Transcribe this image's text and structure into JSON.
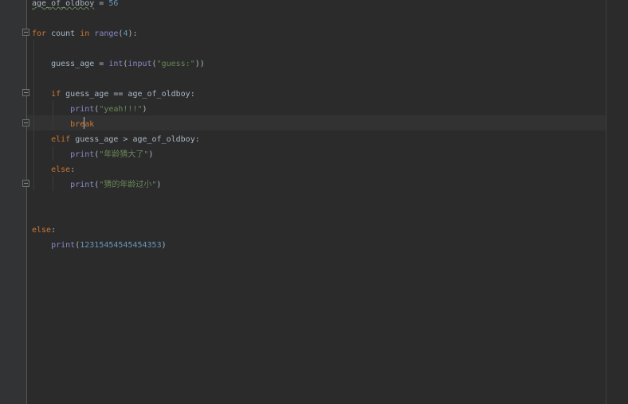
{
  "editor": {
    "lines": [
      {
        "parts": [
          {
            "t": "age_of_oldboy",
            "c": "var squiggle"
          },
          {
            "t": " = ",
            "c": "var"
          },
          {
            "t": "56",
            "c": "num"
          }
        ]
      },
      {
        "parts": []
      },
      {
        "parts": [
          {
            "t": "for",
            "c": "kw"
          },
          {
            "t": " count ",
            "c": "var"
          },
          {
            "t": "in",
            "c": "kw"
          },
          {
            "t": " ",
            "c": "var"
          },
          {
            "t": "range",
            "c": "bi"
          },
          {
            "t": "(",
            "c": "var"
          },
          {
            "t": "4",
            "c": "num"
          },
          {
            "t": "):",
            "c": "var"
          }
        ]
      },
      {
        "parts": []
      },
      {
        "parts": [
          {
            "t": "    guess_age = ",
            "c": "var"
          },
          {
            "t": "int",
            "c": "bi"
          },
          {
            "t": "(",
            "c": "var"
          },
          {
            "t": "input",
            "c": "bi"
          },
          {
            "t": "(",
            "c": "var"
          },
          {
            "t": "\"guess:\"",
            "c": "str"
          },
          {
            "t": "))",
            "c": "var"
          }
        ]
      },
      {
        "parts": []
      },
      {
        "parts": [
          {
            "t": "    ",
            "c": "var"
          },
          {
            "t": "if",
            "c": "kw"
          },
          {
            "t": " guess_age == age_of_oldboy:",
            "c": "var"
          }
        ]
      },
      {
        "parts": [
          {
            "t": "        ",
            "c": "var"
          },
          {
            "t": "print",
            "c": "bi"
          },
          {
            "t": "(",
            "c": "var"
          },
          {
            "t": "\"yeah!!!\"",
            "c": "str"
          },
          {
            "t": ")",
            "c": "var"
          }
        ]
      },
      {
        "parts": [
          {
            "t": "        ",
            "c": "var"
          },
          {
            "t": "break",
            "c": "kw"
          }
        ]
      },
      {
        "parts": [
          {
            "t": "    ",
            "c": "var"
          },
          {
            "t": "elif",
            "c": "kw"
          },
          {
            "t": " guess_age > age_of_oldboy:",
            "c": "var"
          }
        ]
      },
      {
        "parts": [
          {
            "t": "        ",
            "c": "var"
          },
          {
            "t": "print",
            "c": "bi"
          },
          {
            "t": "(",
            "c": "var"
          },
          {
            "t": "\"年龄猜大了\"",
            "c": "str"
          },
          {
            "t": ")",
            "c": "var"
          }
        ]
      },
      {
        "parts": [
          {
            "t": "    ",
            "c": "var"
          },
          {
            "t": "else",
            "c": "kw"
          },
          {
            "t": ":",
            "c": "var"
          }
        ]
      },
      {
        "parts": [
          {
            "t": "        ",
            "c": "var"
          },
          {
            "t": "print",
            "c": "bi"
          },
          {
            "t": "(",
            "c": "var"
          },
          {
            "t": "\"猜的年龄过小\"",
            "c": "str"
          },
          {
            "t": ")",
            "c": "var"
          }
        ]
      },
      {
        "parts": []
      },
      {
        "parts": []
      },
      {
        "parts": [
          {
            "t": "else",
            "c": "kw"
          },
          {
            "t": ":",
            "c": "var"
          }
        ]
      },
      {
        "parts": [
          {
            "t": "    ",
            "c": "var"
          },
          {
            "t": "print",
            "c": "bi"
          },
          {
            "t": "(",
            "c": "var"
          },
          {
            "t": "12315454545454353",
            "c": "num"
          },
          {
            "t": ")",
            "c": "var"
          }
        ]
      }
    ],
    "colors": {
      "background": "#2b2b2b",
      "keyword": "#cc7832",
      "builtin": "#8888c6",
      "number": "#6897bb",
      "string": "#6a8759",
      "text": "#a9b7c6"
    }
  }
}
